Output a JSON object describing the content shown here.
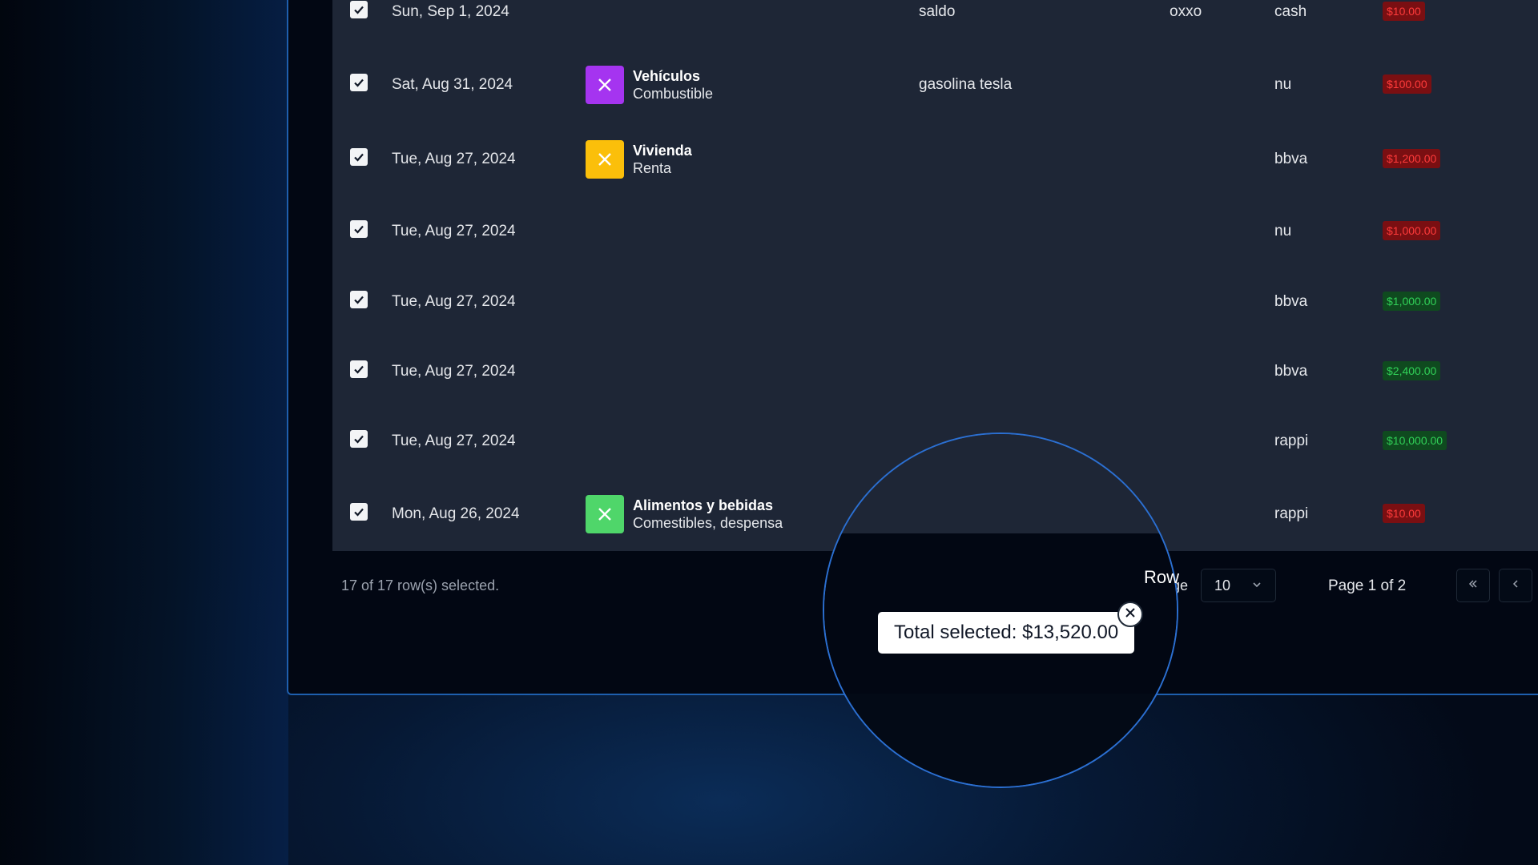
{
  "rows": [
    {
      "date": "Sun, Sep 1, 2024",
      "category": null,
      "description": "saldo",
      "place": "oxxo",
      "account": "cash",
      "amount": "$10.00",
      "sign": "neg"
    },
    {
      "date": "Sat, Aug 31, 2024",
      "category": {
        "name": "Vehículos",
        "sub": "Combustible",
        "color": "#a534f0"
      },
      "description": "gasolina tesla",
      "place": "",
      "account": "nu",
      "amount": "$100.00",
      "sign": "neg"
    },
    {
      "date": "Tue, Aug 27, 2024",
      "category": {
        "name": "Vivienda",
        "sub": "Renta",
        "color": "#fbbf0a"
      },
      "description": "",
      "place": "",
      "account": "bbva",
      "amount": "$1,200.00",
      "sign": "neg"
    },
    {
      "date": "Tue, Aug 27, 2024",
      "category": null,
      "description": "",
      "place": "",
      "account": "nu",
      "amount": "$1,000.00",
      "sign": "neg"
    },
    {
      "date": "Tue, Aug 27, 2024",
      "category": null,
      "description": "",
      "place": "",
      "account": "bbva",
      "amount": "$1,000.00",
      "sign": "pos"
    },
    {
      "date": "Tue, Aug 27, 2024",
      "category": null,
      "description": "",
      "place": "",
      "account": "bbva",
      "amount": "$2,400.00",
      "sign": "pos"
    },
    {
      "date": "Tue, Aug 27, 2024",
      "category": null,
      "description": "",
      "place": "",
      "account": "rappi",
      "amount": "$10,000.00",
      "sign": "pos"
    },
    {
      "date": "Mon, Aug 26, 2024",
      "category": {
        "name": "Alimentos y bebidas",
        "sub": "Comestibles, despensa",
        "color": "#4fd66a"
      },
      "description": "",
      "place": "",
      "account": "rappi",
      "amount": "$10.00",
      "sign": "neg"
    }
  ],
  "footer": {
    "selected_text": "17 of 17 row(s) selected.",
    "rows_label_magnified": "Row",
    "rows_label_suffix": "ge",
    "page_size": "10",
    "page_info": "Page 1 of 2"
  },
  "tooltip": {
    "text": "Total selected: $13,520.00"
  },
  "colors": {
    "negative_bg": "#7a0f12",
    "negative_text": "#ff3b3b",
    "positive_bg": "#0f4a1f",
    "positive_text": "#31d158",
    "accent": "#2b6fd1"
  },
  "icons": {
    "row_checkbox": "check-icon",
    "category": "x-icon",
    "first_page": "chevrons-left-icon",
    "prev_page": "chevron-left-icon",
    "select": "chevron-down-icon",
    "close": "close-icon"
  }
}
